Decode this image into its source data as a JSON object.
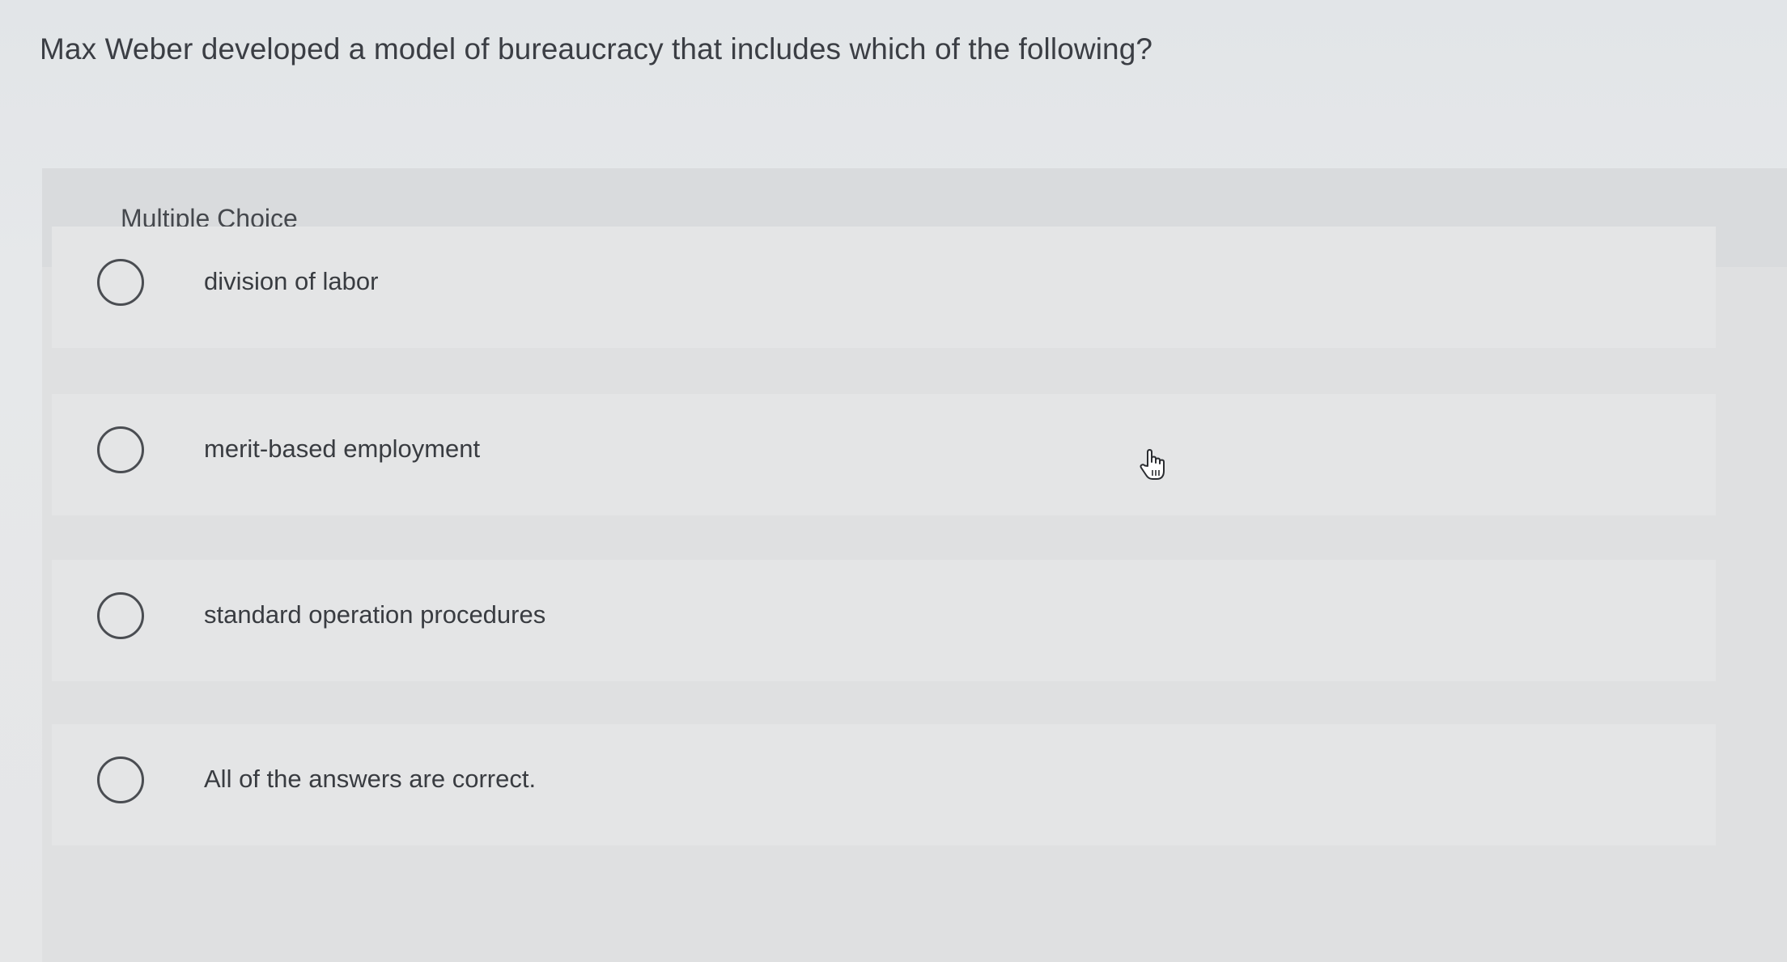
{
  "question": {
    "text": "Max Weber developed a model of bureaucracy that includes which of the following?"
  },
  "panel": {
    "type_label": "Multiple Choice"
  },
  "options": [
    {
      "label": "division of labor"
    },
    {
      "label": "merit-based employment"
    },
    {
      "label": "standard operation procedures"
    },
    {
      "label": "All of the answers are correct."
    }
  ],
  "cursor": {
    "icon": "hand-pointer-icon"
  }
}
